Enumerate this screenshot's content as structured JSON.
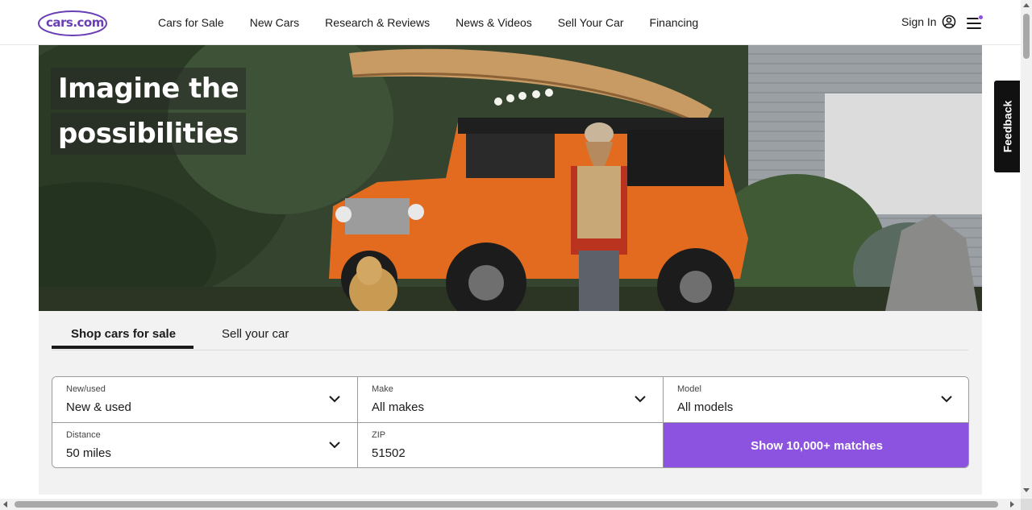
{
  "header": {
    "logo_text": "cars.com",
    "nav": [
      "Cars for Sale",
      "New Cars",
      "Research & Reviews",
      "News & Videos",
      "Sell Your Car",
      "Financing"
    ],
    "sign_in": "Sign In"
  },
  "hero": {
    "headline_line1": "Imagine the",
    "headline_line2": "possibilities"
  },
  "feedback": {
    "label": "Feedback"
  },
  "search": {
    "tabs": [
      "Shop cars for sale",
      "Sell your car"
    ],
    "active_tab": "Shop cars for sale",
    "fields": {
      "new_used": {
        "label": "New/used",
        "value": "New & used"
      },
      "make": {
        "label": "Make",
        "value": "All makes"
      },
      "model": {
        "label": "Model",
        "value": "All models"
      },
      "distance": {
        "label": "Distance",
        "value": "50 miles"
      },
      "zip": {
        "label": "ZIP",
        "value": "51502"
      }
    },
    "submit_label": "Show 10,000+ matches"
  },
  "colors": {
    "brand_purple": "#8c52e0",
    "logo_purple": "#6a3fb5",
    "panel_bg": "#f2f2f2"
  },
  "icons": [
    "account-icon",
    "hamburger-menu-icon",
    "chevron-down-icon"
  ]
}
